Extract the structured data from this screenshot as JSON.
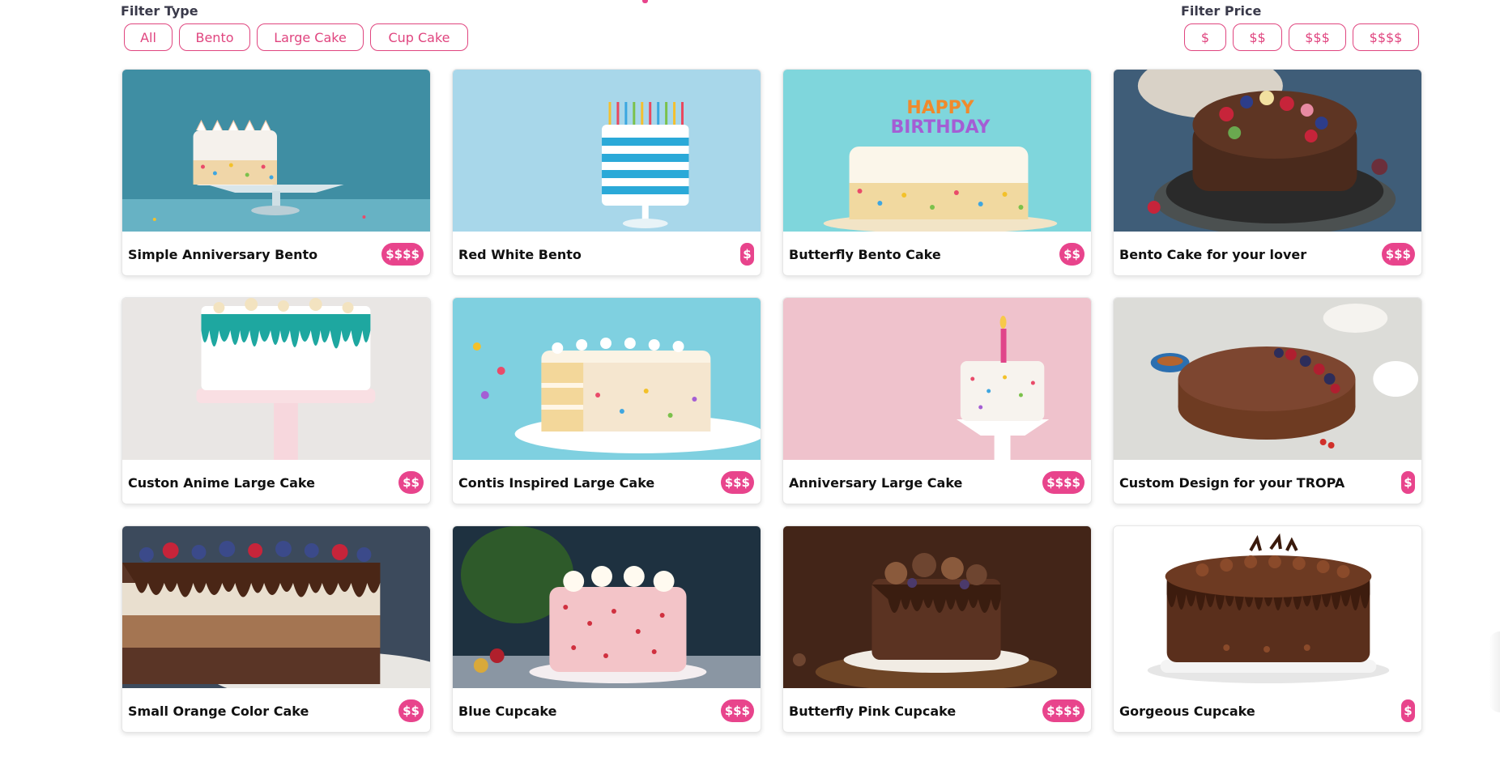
{
  "filters": {
    "type": {
      "label": "Filter Type",
      "options": [
        "All",
        "Bento",
        "Large Cake",
        "Cup Cake"
      ]
    },
    "price": {
      "label": "Filter Price",
      "options": [
        "$",
        "$$",
        "$$$",
        "$$$$"
      ]
    }
  },
  "colors": {
    "accent": "#e8448c",
    "chip_border": "#e0457f"
  },
  "products": [
    {
      "name": "Simple Anniversary Bento",
      "price": "$$$$"
    },
    {
      "name": "Red White Bento",
      "price": "$"
    },
    {
      "name": "Butterfly Bento Cake",
      "price": "$$"
    },
    {
      "name": "Bento Cake for your lover",
      "price": "$$$"
    },
    {
      "name": "Custon Anime Large Cake",
      "price": "$$"
    },
    {
      "name": "Contis Inspired Large Cake",
      "price": "$$$"
    },
    {
      "name": "Anniversary Large Cake",
      "price": "$$$$"
    },
    {
      "name": "Custom Design for your TROPA",
      "price": "$"
    },
    {
      "name": "Small Orange Color Cake",
      "price": "$$"
    },
    {
      "name": "Blue Cupcake",
      "price": "$$$"
    },
    {
      "name": "Butterfly Pink Cupcake",
      "price": "$$$$"
    },
    {
      "name": "Gorgeous Cupcake",
      "price": "$"
    }
  ],
  "images": {
    "p0": "cake-photo-sprinkles-teal",
    "p1": "cake-photo-striped-candles",
    "p2": "cake-photo-happy-birthday",
    "p3": "cake-photo-chocolate-berries",
    "p4": "cake-photo-teal-drip",
    "p5": "cake-photo-sliced-confetti",
    "p6": "cake-photo-single-candle-pink",
    "p7": "cake-photo-chocolate-tart",
    "p8": "cake-photo-mousse-berries",
    "p9": "cake-photo-peppermint",
    "p10": "cake-photo-chocolate-macarons",
    "p11": "cake-photo-chocolate-swirl"
  },
  "happy_birthday_topper": [
    "HAPPY",
    "BIRTHDAY"
  ]
}
